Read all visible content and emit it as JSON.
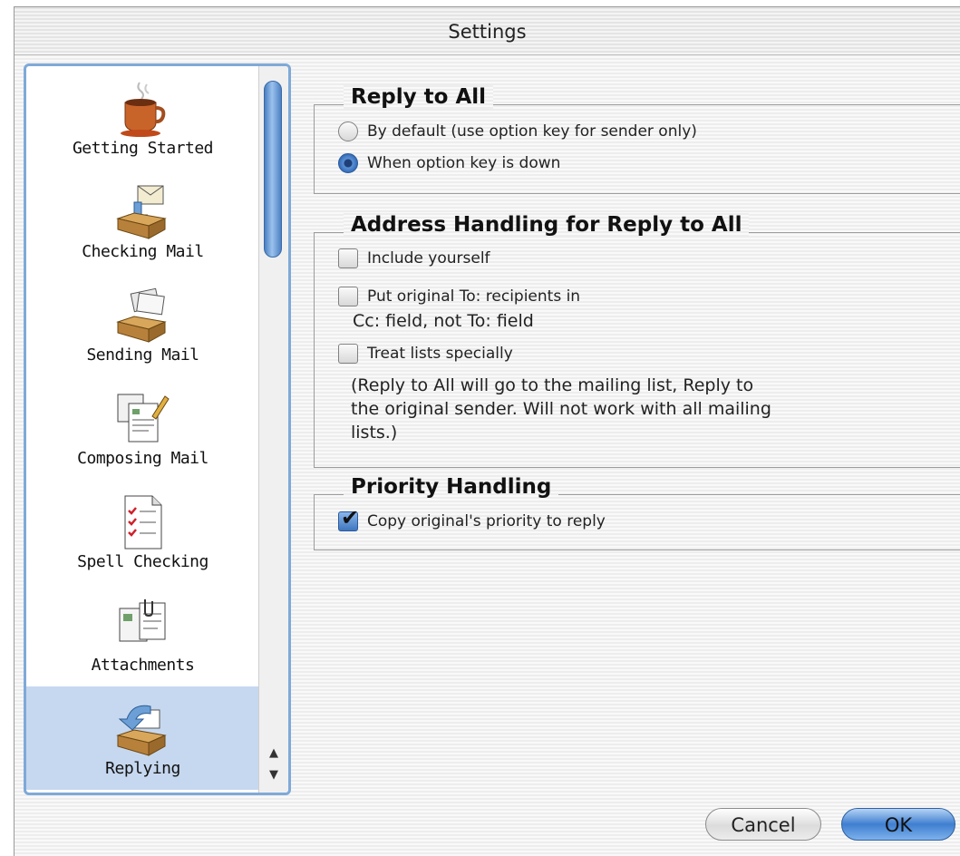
{
  "window": {
    "title": "Settings"
  },
  "sidebar": {
    "items": [
      {
        "label": "Getting Started",
        "icon": "coffee-cup-icon"
      },
      {
        "label": "Checking Mail",
        "icon": "inbox-tray-icon"
      },
      {
        "label": "Sending Mail",
        "icon": "outbox-tray-icon"
      },
      {
        "label": "Composing Mail",
        "icon": "compose-document-icon"
      },
      {
        "label": "Spell Checking",
        "icon": "checklist-icon"
      },
      {
        "label": "Attachments",
        "icon": "attachment-documents-icon"
      },
      {
        "label": "Replying",
        "icon": "reply-tray-icon"
      }
    ],
    "selected": "Replying"
  },
  "reply_to_all": {
    "title": "Reply to All",
    "options": [
      {
        "label": "By default (use option key for sender only)",
        "selected": false
      },
      {
        "label": "When option key is down",
        "selected": true
      }
    ]
  },
  "address_handling": {
    "title": "Address Handling for Reply to All",
    "include_yourself": {
      "label": "Include yourself",
      "checked": false
    },
    "put_original": {
      "label": "Put original To: recipients in",
      "label2": "Cc: field, not To: field",
      "checked": false
    },
    "treat_lists": {
      "label": "Treat lists specially",
      "checked": false
    },
    "note1": "(Reply to All will go to the mailing list, Reply to",
    "note2": "the original sender.  Will not work with all mailing",
    "note3": "lists.)"
  },
  "priority_handling": {
    "title": "Priority Handling",
    "copy_priority": {
      "label": "Copy original's priority to reply",
      "checked": true
    }
  },
  "buttons": {
    "cancel": "Cancel",
    "ok": "OK"
  },
  "colors": {
    "accent": "#3f7fd0",
    "selection": "#c6d8ef"
  }
}
